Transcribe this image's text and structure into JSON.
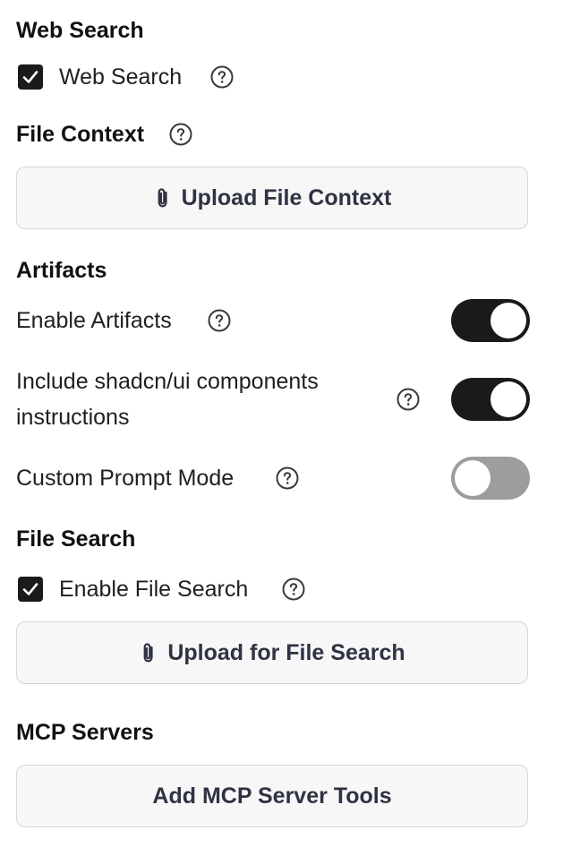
{
  "web_search": {
    "heading": "Web Search",
    "checkbox_label": "Web Search",
    "checked": true
  },
  "file_context": {
    "heading": "File Context",
    "upload_button": "Upload File Context"
  },
  "artifacts": {
    "heading": "Artifacts",
    "enable_label": "Enable Artifacts",
    "enable_on": true,
    "shadcn_label": "Include shadcn/ui components instructions",
    "shadcn_on": true,
    "custom_prompt_label": "Custom Prompt Mode",
    "custom_prompt_on": false
  },
  "file_search": {
    "heading": "File Search",
    "checkbox_label": "Enable File Search",
    "checked": true,
    "upload_button": "Upload for File Search"
  },
  "mcp": {
    "heading": "MCP Servers",
    "add_button": "Add MCP Server Tools"
  },
  "icons": {
    "help": "question-circle-icon",
    "check": "checkmark-icon",
    "attach": "paperclip-icon"
  },
  "colors": {
    "toggle_on": "#1a1a1a",
    "toggle_off": "#9d9d9d",
    "button_bg": "#f7f7f7",
    "button_text": "#2f3342"
  }
}
